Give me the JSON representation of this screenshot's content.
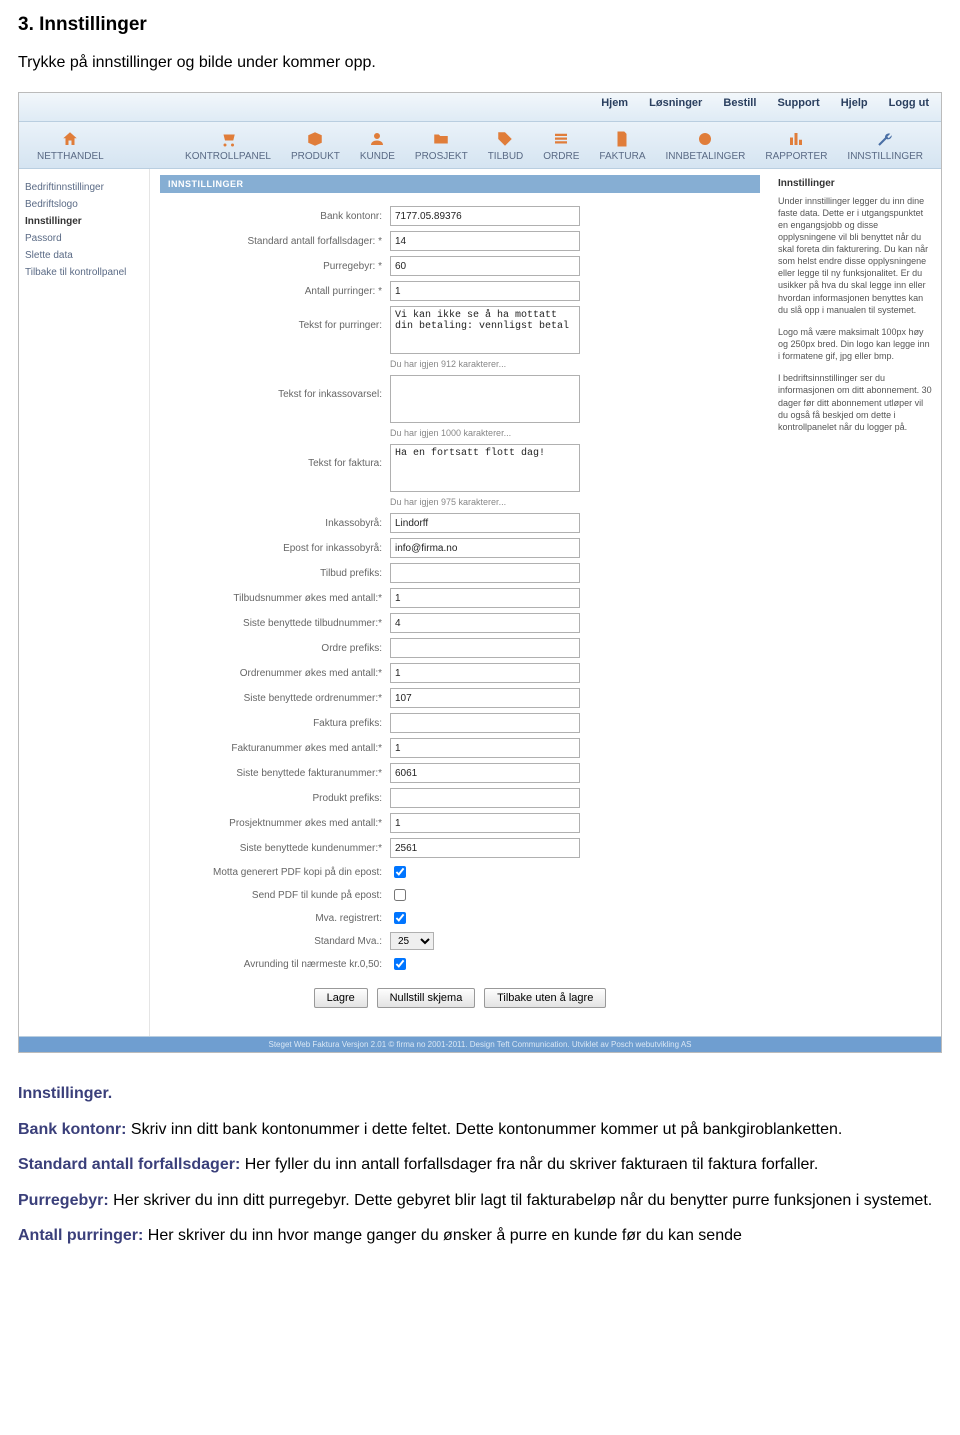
{
  "doc": {
    "heading": "3. Innstillinger",
    "intro": "Trykke på innstillinger og bilde under kommer opp.",
    "p1_label": "Innstillinger.",
    "p2_label": "Bank kontonr:",
    "p2_text": " Skriv inn ditt bank kontonummer i dette feltet. Dette kontonummer kommer ut på bankgiroblanketten.",
    "p3_label": "Standard antall forfallsdager:",
    "p3_text": " Her fyller du inn antall forfallsdager fra når du skriver fakturaen til faktura forfaller.",
    "p4_label": "Purregebyr:",
    "p4_text": " Her skriver du inn ditt purregebyr. Dette gebyret blir lagt til fakturabeløp når du benytter purre funksjonen i systemet.",
    "p5_label": "Antall purringer:",
    "p5_text": " Her skriver du inn hvor mange ganger du ønsker å purre en kunde før du kan sende"
  },
  "topnav": {
    "hjem": "Hjem",
    "losninger": "Løsninger",
    "bestill": "Bestill",
    "support": "Support",
    "hjelp": "Hjelp",
    "loggut": "Logg ut"
  },
  "nav": {
    "netthandel": "NETTHANDEL",
    "kontrollpanel": "KONTROLLPANEL",
    "produkt": "PRODUKT",
    "kunde": "KUNDE",
    "prosjekt": "PROSJEKT",
    "tilbud": "TILBUD",
    "ordre": "ORDRE",
    "faktura": "FAKTURA",
    "innbetalinger": "INNBETALINGER",
    "rapporter": "RAPPORTER",
    "innstillinger": "INNSTILLINGER"
  },
  "sidebarLeft": {
    "i0": "Bedriftinnstillinger",
    "i1": "Bedriftslogo",
    "i2": "Innstillinger",
    "i3": "Passord",
    "i4": "Slette data",
    "i5": "Tilbake til kontrollpanel"
  },
  "panel": {
    "title": "INNSTILLINGER"
  },
  "form": {
    "l_bank": "Bank kontonr:",
    "v_bank": "7177.05.89376",
    "l_forfall": "Standard antall forfallsdager: *",
    "v_forfall": "14",
    "l_purregebyr": "Purregebyr: *",
    "v_purregebyr": "60",
    "l_antallpur": "Antall purringer: *",
    "v_antallpur": "1",
    "l_tekstpur": "Tekst for purringer:",
    "v_tekstpur": "Vi kan ikke se å ha mottatt din betaling: vennligst betal",
    "h_tekstpur": "Du har igjen 912 karakterer...",
    "l_inkvarsel": "Tekst for inkassovarsel:",
    "v_inkvarsel": "",
    "h_inkvarsel": "Du har igjen 1000 karakterer...",
    "l_faktura": "Tekst for faktura:",
    "v_faktura": "Ha en fortsatt flott dag!",
    "h_faktura": "Du har igjen 975 karakterer...",
    "l_inkbyra": "Inkassobyrå:",
    "v_inkbyra": "Lindorff",
    "l_epostink": "Epost for inkassobyrå:",
    "v_epostink": "info@firma.no",
    "l_tilbudpre": "Tilbud prefiks:",
    "v_tilbudpre": "",
    "l_tilbudokes": "Tilbudsnummer økes med antall:*",
    "v_tilbudokes": "1",
    "l_sistetilbud": "Siste benyttede tilbudnummer:*",
    "v_sistetilbud": "4",
    "l_ordrepre": "Ordre prefiks:",
    "v_ordrepre": "",
    "l_ordreokes": "Ordrenummer økes med antall:*",
    "v_ordreokes": "1",
    "l_sisteordre": "Siste benyttede ordrenummer:*",
    "v_sisteordre": "107",
    "l_fakturapre": "Faktura prefiks:",
    "v_fakturapre": "",
    "l_fakturaokes": "Fakturanummer økes med antall:*",
    "v_fakturaokes": "1",
    "l_sistefaktura": "Siste benyttede fakturanummer:*",
    "v_sistefaktura": "6061",
    "l_prodpre": "Produkt prefiks:",
    "v_prodpre": "",
    "l_prosjokes": "Prosjektnummer økes med antall:*",
    "v_prosjokes": "1",
    "l_sistekunde": "Siste benyttede kundenummer:*",
    "v_sistekunde": "2561",
    "l_pdfkopi": "Motta generert PDF kopi på din epost:",
    "l_sendpdf": "Send PDF til kunde på epost:",
    "l_mvareg": "Mva. registrert:",
    "l_stdmva": "Standard Mva.:",
    "v_stdmva": "25",
    "l_avrund": "Avrunding til nærmeste kr.0,50:"
  },
  "buttons": {
    "lagre": "Lagre",
    "nullstill": "Nullstill skjema",
    "tilbake": "Tilbake uten å lagre"
  },
  "sidebarRight": {
    "title": "Innstillinger",
    "p1": "Under innstillinger legger du inn dine faste data. Dette er i utgangspunktet en engangsjobb og disse opplysningene vil bli benyttet når du skal foreta din fakturering. Du kan når som helst endre disse opplysningene eller legge til ny funksjonalitet. Er du usikker på hva du skal legge inn eller hvordan informasjonen benyttes kan du slå opp i manualen til systemet.",
    "p2": "Logo må være maksimalt 100px høy og 250px bred. Din logo kan legge inn i formatene gif, jpg eller bmp.",
    "p3": "I bedriftsinnstillinger ser du informasjonen om ditt abonnement. 30 dager før ditt abonnement utløper vil du også få beskjed om dette i kontrollpanelet når du logger på."
  },
  "footer": "Steget Web Faktura Versjon 2.01 © firma no 2001-2011. Design Teft Communication. Utviklet av Posch webutvikling AS"
}
